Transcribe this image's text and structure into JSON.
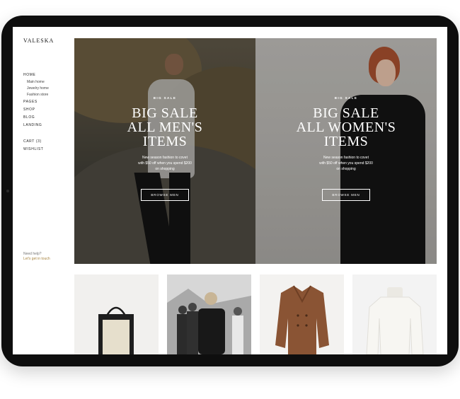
{
  "brand": {
    "logo": "VALESKA"
  },
  "sidebar": {
    "items": [
      {
        "label": "HOME"
      },
      {
        "label": "PAGES"
      },
      {
        "label": "SHOP"
      },
      {
        "label": "BLOG"
      },
      {
        "label": "LANDING"
      }
    ],
    "home_sub": [
      "Main home",
      "Jewelry home",
      "Fashion store"
    ],
    "cart": "CART (3)",
    "wishlist": "WISHLIST",
    "help_question": "Need help?",
    "help_link": "Let's get in touch"
  },
  "heroes": [
    {
      "eyebrow": "BIG SALE",
      "title_lines": [
        "BIG SALE",
        "ALL MEN'S",
        "ITEMS"
      ],
      "desc_lines": [
        "New season fashion to covet",
        "with $50 off when you spend $200",
        "on shopping"
      ],
      "button": "BROWSE MEN"
    },
    {
      "eyebrow": "BIG SALE",
      "title_lines": [
        "BIG SALE",
        "ALL WOMEN'S",
        "ITEMS"
      ],
      "desc_lines": [
        "New season fashion to covet",
        "with $50 off when you spend $200",
        "on shopping"
      ],
      "button": "BROWSE MEN"
    }
  ],
  "products": [
    {
      "image": "tote-bag-image"
    },
    {
      "image": "group-photo-image"
    },
    {
      "image": "brown-coat-image"
    },
    {
      "image": "white-turtleneck-image"
    }
  ],
  "colors": {
    "accent_link": "#a8843f",
    "tablet_frame": "#0e0e0e"
  }
}
